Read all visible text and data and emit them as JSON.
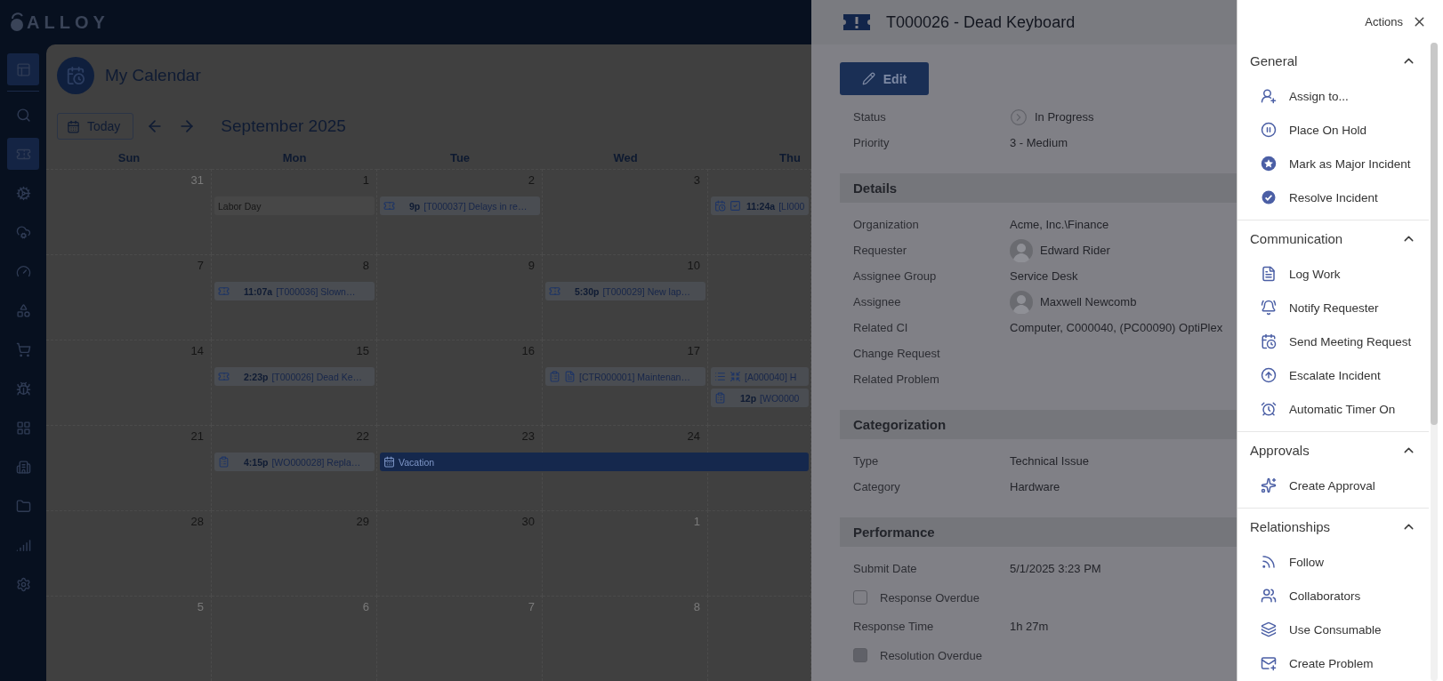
{
  "logo": {
    "text": "ALLOY"
  },
  "sidebar": {
    "items": [
      {
        "selected": true
      },
      {
        "selected": false
      },
      {
        "selected": true
      },
      {
        "selected": false
      },
      {
        "selected": false
      },
      {
        "selected": false
      },
      {
        "selected": false
      },
      {
        "selected": false
      },
      {
        "selected": false
      },
      {
        "selected": false
      },
      {
        "selected": false
      },
      {
        "selected": false
      },
      {
        "selected": false
      },
      {
        "selected": false
      }
    ]
  },
  "calendar": {
    "title": "My Calendar",
    "today_button": "Today",
    "month": "September 2025",
    "weekdays": [
      "Sun",
      "Mon",
      "Tue",
      "Wed",
      "Thu"
    ],
    "weeks": [
      {
        "days": [
          {
            "number": "31",
            "outside_month": true
          },
          {
            "number": "1",
            "outside_month": false,
            "events": [
              {
                "kind": "holiday",
                "title": "Labor Day"
              }
            ]
          },
          {
            "number": "2",
            "outside_month": false,
            "events": [
              {
                "kind": "ticket",
                "time": "9p",
                "title": "[T000037] Delays in re…"
              }
            ]
          },
          {
            "number": "3",
            "outside_month": false
          },
          {
            "events": [
              {
                "kind": "meeting",
                "time": "11:24a",
                "title": "[LI000"
              }
            ]
          }
        ]
      },
      {
        "days": [
          {
            "number": "7",
            "outside_month": false
          },
          {
            "number": "8",
            "outside_month": false,
            "events": [
              {
                "kind": "ticket",
                "time": "11:07a",
                "title": "[T000036] Slown…"
              }
            ]
          },
          {
            "number": "9",
            "outside_month": false
          },
          {
            "number": "10",
            "outside_month": false,
            "events": [
              {
                "kind": "ticket",
                "time": "5:30p",
                "title": "[T000029] New lap…"
              }
            ]
          }
        ]
      },
      {
        "days": [
          {
            "number": "14",
            "outside_month": false
          },
          {
            "number": "15",
            "outside_month": false,
            "events": [
              {
                "kind": "ticket",
                "time": "2:23p",
                "title": "[T000026] Dead Ke…"
              }
            ]
          },
          {
            "number": "16",
            "outside_month": false
          },
          {
            "number": "17",
            "outside_month": false,
            "events": [
              {
                "kind": "contract",
                "title": "[CTR000001] Maintenan…"
              }
            ]
          },
          {
            "events": [
              {
                "kind": "asset",
                "title": "[A000040] H"
              },
              {
                "kind": "workorder",
                "time": "12p",
                "title": "[WO0000"
              }
            ]
          }
        ]
      },
      {
        "days": [
          {
            "number": "21",
            "outside_month": false
          },
          {
            "number": "22",
            "outside_month": false,
            "events": [
              {
                "kind": "workorder",
                "time": "4:15p",
                "title": "[WO000028] Repla…"
              }
            ]
          },
          {
            "number": "23",
            "outside_month": false,
            "events": [
              {
                "kind": "vacation",
                "title": "Vacation"
              }
            ]
          },
          {
            "number": "24",
            "outside_month": false
          }
        ]
      },
      {
        "days": [
          {
            "number": "28",
            "outside_month": false
          },
          {
            "number": "29",
            "outside_month": false
          },
          {
            "number": "30",
            "outside_month": false
          },
          {
            "number": "1",
            "outside_month": true
          }
        ]
      },
      {
        "days": [
          {
            "number": "5",
            "outside_month": true
          },
          {
            "number": "6",
            "outside_month": true
          },
          {
            "number": "7",
            "outside_month": true
          },
          {
            "number": "8",
            "outside_month": true
          }
        ]
      }
    ]
  },
  "detail": {
    "title": "T000026 - Dead Keyboard",
    "edit_button": "Edit",
    "summary": [
      {
        "label": "Status",
        "value": "In Progress",
        "kind": "status"
      },
      {
        "label": "Priority",
        "value": "3 - Medium",
        "kind": "text"
      }
    ],
    "sections": [
      {
        "title": "Details",
        "fields": [
          {
            "label": "Organization",
            "value": "Acme, Inc.\\Finance",
            "kind": "text"
          },
          {
            "label": "Requester",
            "value": "Edward Rider",
            "kind": "person"
          },
          {
            "label": "Assignee Group",
            "value": "Service Desk",
            "kind": "text"
          },
          {
            "label": "Assignee",
            "value": "Maxwell Newcomb",
            "kind": "person"
          },
          {
            "label": "Related CI",
            "value": "Computer, C000040, (PC00090) OptiPlex",
            "kind": "text"
          },
          {
            "label": "Change Request",
            "kind": "text"
          },
          {
            "label": "Related Problem",
            "kind": "text"
          }
        ]
      },
      {
        "title": "Categorization",
        "fields": [
          {
            "label": "Type",
            "value": "Technical Issue",
            "kind": "text"
          },
          {
            "label": "Category",
            "value": "Hardware",
            "kind": "text"
          }
        ]
      },
      {
        "title": "Performance",
        "fields": [
          {
            "label": "Submit Date",
            "value": "5/1/2025 3:23 PM",
            "kind": "text"
          },
          {
            "label": "Response Overdue",
            "kind": "checkbox",
            "checked": false
          },
          {
            "label": "Response Time",
            "value": "1h 27m",
            "kind": "text"
          },
          {
            "label": "Resolution Overdue",
            "kind": "checkbox",
            "checked": true
          }
        ]
      }
    ]
  },
  "actions": {
    "title": "Actions",
    "sections": [
      {
        "title": "General",
        "expanded": true,
        "items": [
          "Assign to...",
          "Place On Hold",
          "Mark as Major Incident",
          "Resolve Incident"
        ]
      },
      {
        "title": "Communication",
        "expanded": true,
        "items": [
          "Log Work",
          "Notify Requester",
          "Send Meeting Request",
          "Escalate Incident",
          "Automatic Timer On"
        ]
      },
      {
        "title": "Approvals",
        "expanded": true,
        "items": [
          "Create Approval"
        ]
      },
      {
        "title": "Relationships",
        "expanded": true,
        "items": [
          "Follow",
          "Collaborators",
          "Use Consumable",
          "Create Problem"
        ]
      }
    ]
  }
}
